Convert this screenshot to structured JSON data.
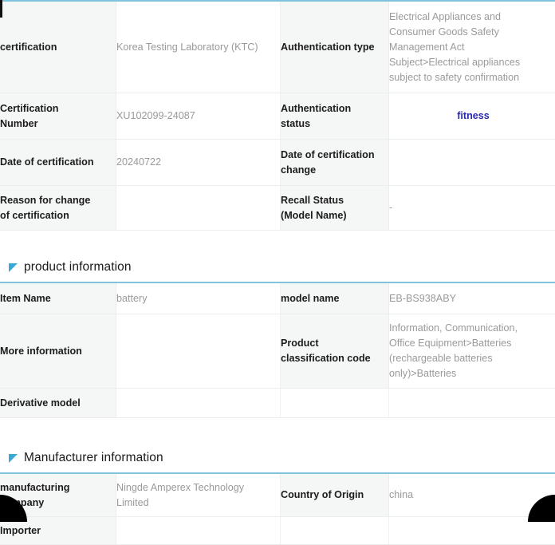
{
  "sections": [
    {
      "id": "certification",
      "title": null,
      "rows": [
        {
          "label_a": "certification",
          "value_a": "Korea Testing Laboratory (KTC)",
          "label_b": "Authentication type",
          "value_b": "Electrical Appliances and\nConsumer Goods Safety\nManagement Act\nSubject>Electrical appliances\nsubject to safety confirmation",
          "value_b_style": "normal"
        },
        {
          "label_a": "Certification\nNumber",
          "value_a": "XU102099-24087",
          "label_b": "Authentication\nstatus",
          "value_b": "fitness",
          "value_b_style": "status"
        },
        {
          "label_a": "Date of certification",
          "value_a": "20240722",
          "label_b": "Date of certification\nchange",
          "value_b": "",
          "value_b_style": "normal"
        },
        {
          "label_a": "Reason for change\nof certification",
          "value_a": "",
          "label_b": "Recall Status\n(Model Name)",
          "value_b": "-",
          "value_b_style": "dash"
        }
      ]
    },
    {
      "id": "product-information",
      "title": "product information",
      "rows": [
        {
          "label_a": "Item Name",
          "value_a": "battery",
          "label_b": "model name",
          "value_b": "EB-BS938ABY",
          "value_b_style": "normal"
        },
        {
          "label_a": "More information",
          "value_a": "",
          "label_b": "Product\nclassification code",
          "value_b": "Information, Communication,\nOffice Equipment>Batteries\n(rechargeable batteries\nonly)>Batteries",
          "value_b_style": "normal"
        },
        {
          "label_a": "Derivative model",
          "value_a": "",
          "label_b": "",
          "value_b": "",
          "value_b_style": "normal"
        }
      ]
    },
    {
      "id": "manufacturer-information",
      "title": "Manufacturer information",
      "rows": [
        {
          "label_a": "manufacturing\ncompany",
          "value_a": "Ningde Amperex Technology\nLimited",
          "label_b": "Country of Origin",
          "value_b": "china",
          "value_b_style": "normal"
        },
        {
          "label_a": "Importer",
          "value_a": "",
          "label_b": "",
          "value_b": "",
          "value_b_style": "normal"
        }
      ]
    }
  ],
  "colors": {
    "table_top_border": "#7fc3dd",
    "flag_icon": "#3aa8d4",
    "status_text": "#2a2ab0",
    "header_cell_bg": "#f5f6f6",
    "value_text": "#9a9a9a",
    "label_text": "#1c1c1c"
  },
  "icons": {
    "section_flag": "flag-icon"
  }
}
